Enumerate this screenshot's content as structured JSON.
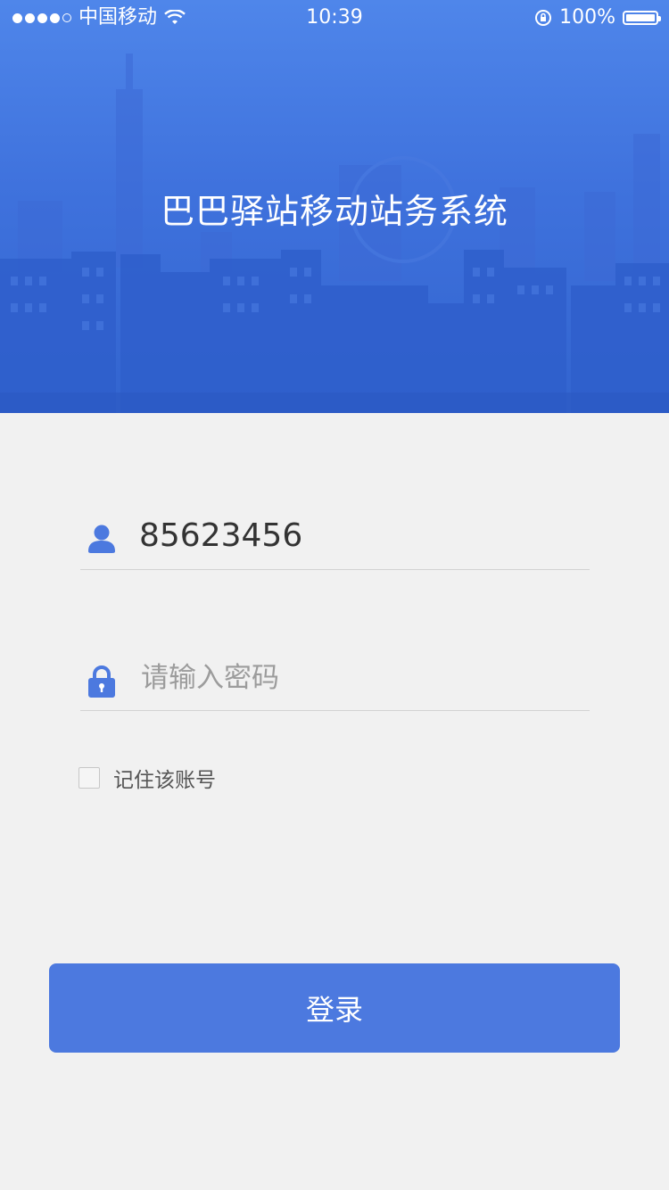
{
  "status_bar": {
    "carrier": "中国移动",
    "time": "10:39",
    "battery_percent": "100%"
  },
  "header": {
    "title": "巴巴驿站移动站务系统"
  },
  "form": {
    "username": {
      "icon": "user-icon",
      "value": "85623456"
    },
    "password": {
      "icon": "lock-icon",
      "placeholder": "请输入密码"
    },
    "remember": {
      "label": "记住该账号",
      "checked": false
    }
  },
  "login_button": {
    "label": "登录"
  },
  "colors": {
    "primary": "#4c79df",
    "banner": "#3f72dd",
    "background": "#f1f1f1"
  }
}
